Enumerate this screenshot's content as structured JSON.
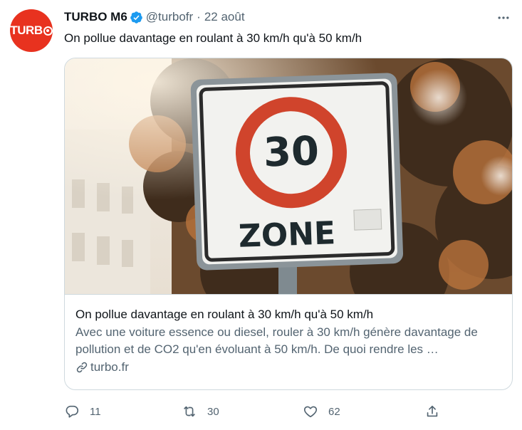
{
  "author": {
    "avatar_text": "TURB",
    "display_name": "TURBO M6",
    "handle": "@turbofr",
    "separator": "·",
    "date": "22 août"
  },
  "tweet": {
    "text": "On pollue davantage en roulant à 30 km/h qu'à 50 km/h"
  },
  "card": {
    "sign_number": "30",
    "sign_zone": "ZONE",
    "title": "On pollue davantage en roulant à 30 km/h qu'à 50 km/h",
    "description": "Avec une voiture essence ou diesel, rouler à 30 km/h génère davantage de pollution et de CO2 qu'en évoluant à 50 km/h. De quoi rendre les …",
    "domain": "turbo.fr"
  },
  "actions": {
    "replies": "11",
    "retweets": "30",
    "likes": "62"
  },
  "colors": {
    "brand": "#e8321f",
    "verified": "#1d9bf0",
    "secondary_text": "#536471",
    "border": "#cfd9de"
  },
  "icons": [
    "more-icon",
    "verified-icon",
    "link-icon",
    "reply-icon",
    "retweet-icon",
    "like-icon",
    "share-icon"
  ]
}
